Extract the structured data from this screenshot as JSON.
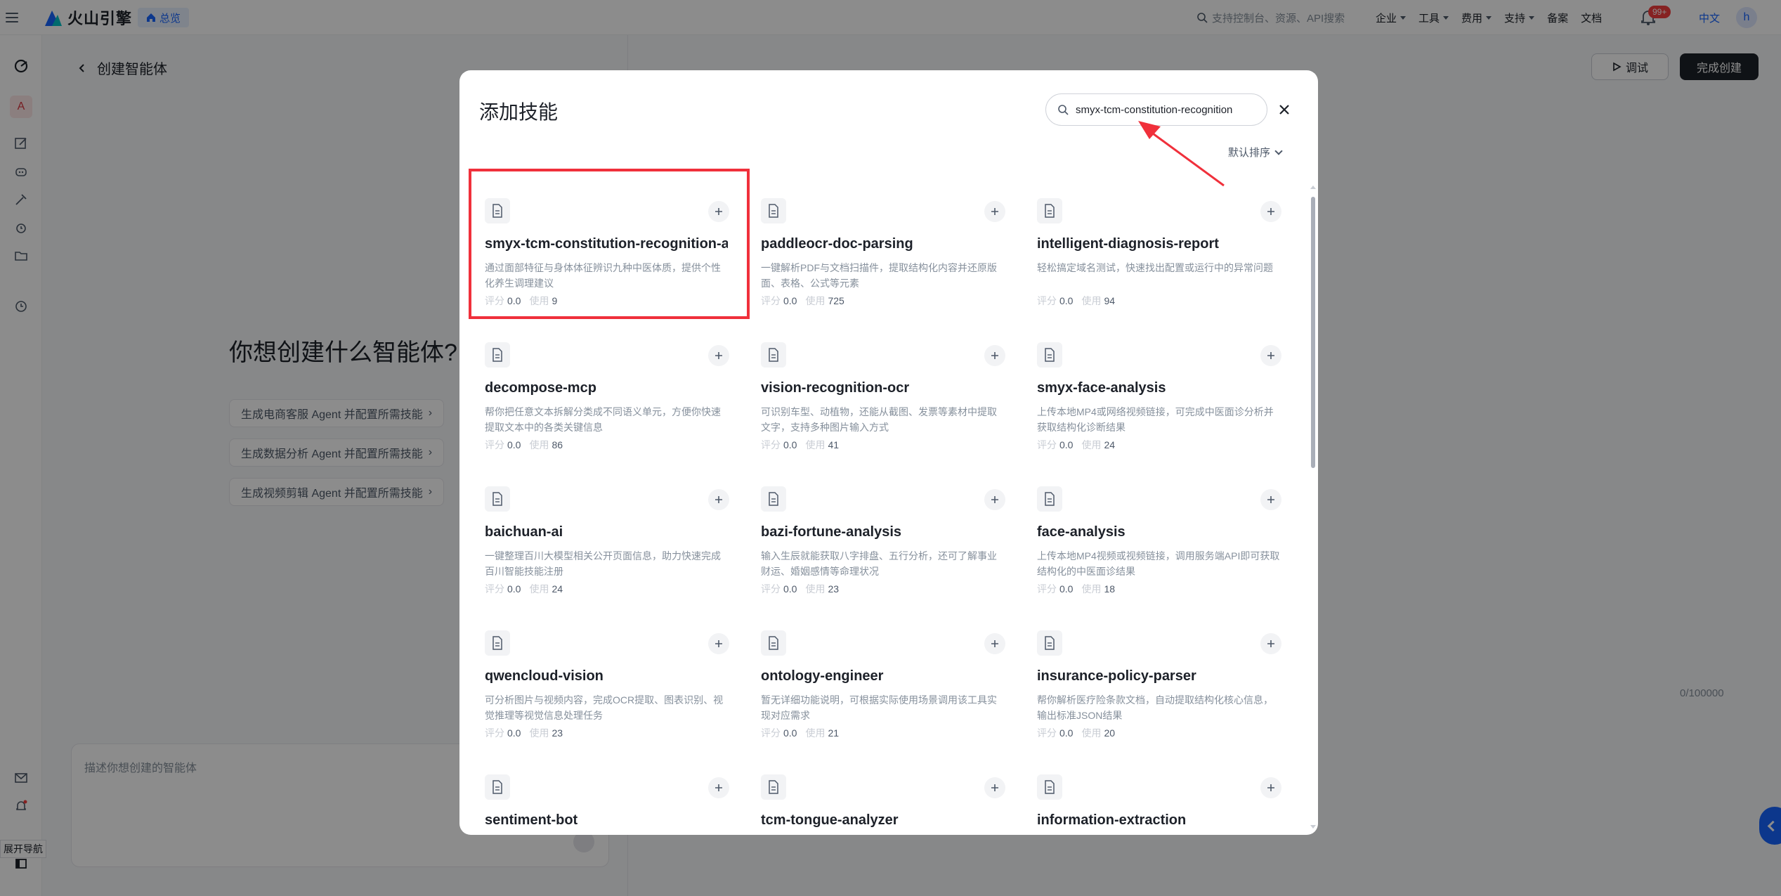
{
  "topbar": {
    "brand": "火山引擎",
    "overview_tag": "总览",
    "search_placeholder": "支持控制台、资源、API搜索",
    "nav": [
      "企业",
      "工具",
      "费用",
      "支持",
      "备案",
      "文档"
    ],
    "badge": "99+",
    "language": "中文",
    "avatar_letter": "h"
  },
  "rail": {
    "avatar_letter": "A",
    "expand_tip": "展开导航"
  },
  "page": {
    "back_title": "创建智能体",
    "debug_label": "调试",
    "finish_label": "完成创建",
    "question": "你想创建什么智能体?",
    "suggestions": [
      "生成电商客服 Agent 并配置所需技能",
      "生成数据分析 Agent 并配置所需技能",
      "生成视频剪辑 Agent 并配置所需技能"
    ],
    "textarea_placeholder": "描述你想创建的智能体",
    "char_count": "0/100000"
  },
  "modal": {
    "title": "添加技能",
    "search_value": "smyx-tcm-constitution-recognition",
    "sort_label": "默认排序",
    "score_label": "评分",
    "usage_label": "使用",
    "skills": [
      {
        "name": "smyx-tcm-constitution-recognition-analysis",
        "desc": "通过面部特征与身体体征辨识九种中医体质，提供个性化养生调理建议",
        "score": "0.0",
        "usage": "9"
      },
      {
        "name": "paddleocr-doc-parsing",
        "desc": "一键解析PDF与文档扫描件，提取结构化内容并还原版面、表格、公式等元素",
        "score": "0.0",
        "usage": "725"
      },
      {
        "name": "intelligent-diagnosis-report",
        "desc": "轻松搞定域名测试，快速找出配置或运行中的异常问题",
        "score": "0.0",
        "usage": "94"
      },
      {
        "name": "decompose-mcp",
        "desc": "帮你把任意文本拆解分类成不同语义单元，方便你快速提取文本中的各类关键信息",
        "score": "0.0",
        "usage": "86"
      },
      {
        "name": "vision-recognition-ocr",
        "desc": "可识别车型、动植物，还能从截图、发票等素材中提取文字，支持多种图片输入方式",
        "score": "0.0",
        "usage": "41"
      },
      {
        "name": "smyx-face-analysis",
        "desc": "上传本地MP4或网络视频链接，可完成中医面诊分析并获取结构化诊断结果",
        "score": "0.0",
        "usage": "24"
      },
      {
        "name": "baichuan-ai",
        "desc": "一键整理百川大模型相关公开页面信息，助力快速完成百川智能技能注册",
        "score": "0.0",
        "usage": "24"
      },
      {
        "name": "bazi-fortune-analysis",
        "desc": "输入生辰就能获取八字排盘、五行分析，还可了解事业财运、婚姻感情等命理状况",
        "score": "0.0",
        "usage": "23"
      },
      {
        "name": "face-analysis",
        "desc": "上传本地MP4视频或视频链接，调用服务端API即可获取结构化的中医面诊结果",
        "score": "0.0",
        "usage": "18"
      },
      {
        "name": "qwencloud-vision",
        "desc": "可分析图片与视频内容，完成OCR提取、图表识别、视觉推理等视觉信息处理任务",
        "score": "0.0",
        "usage": "23"
      },
      {
        "name": "ontology-engineer",
        "desc": "暂无详细功能说明，可根据实际使用场景调用该工具实现对应需求",
        "score": "0.0",
        "usage": "21"
      },
      {
        "name": "insurance-policy-parser",
        "desc": "帮你解析医疗险条款文档，自动提取结构化核心信息，输出标准JSON结果",
        "score": "0.0",
        "usage": "20"
      },
      {
        "name": "sentiment-bot",
        "desc": "",
        "score": "",
        "usage": ""
      },
      {
        "name": "tcm-tongue-analyzer",
        "desc": "",
        "score": "",
        "usage": ""
      },
      {
        "name": "information-extraction",
        "desc": "",
        "score": "",
        "usage": ""
      }
    ]
  },
  "colors": {
    "accent": "#1664ff",
    "highlight": "#f0303b",
    "overlay": "rgba(0,0,0,0.45)"
  }
}
